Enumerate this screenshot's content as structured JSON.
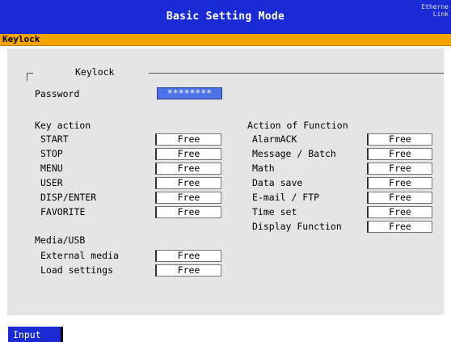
{
  "header": {
    "title": "Basic Setting Mode",
    "status_line1": "Etherne",
    "status_line2": "Link"
  },
  "breadcrumb": "Keylock",
  "group": {
    "title": "Keylock",
    "password_label": "Password",
    "password_value": "********"
  },
  "key_action": {
    "heading": "Key action",
    "items": [
      {
        "label": "START",
        "value": "Free"
      },
      {
        "label": "STOP",
        "value": "Free"
      },
      {
        "label": "MENU",
        "value": "Free"
      },
      {
        "label": "USER",
        "value": "Free"
      },
      {
        "label": "DISP/ENTER",
        "value": "Free"
      },
      {
        "label": "FAVORITE",
        "value": "Free"
      }
    ]
  },
  "media": {
    "heading": "Media/USB",
    "items": [
      {
        "label": "External media",
        "value": "Free"
      },
      {
        "label": "Load settings",
        "value": "Free"
      }
    ]
  },
  "function_action": {
    "heading": "Action of Function",
    "items": [
      {
        "label": "AlarmACK",
        "value": "Free"
      },
      {
        "label": "Message / Batch",
        "value": "Free"
      },
      {
        "label": "Math",
        "value": "Free"
      },
      {
        "label": "Data save",
        "value": "Free"
      },
      {
        "label": "E-mail / FTP",
        "value": "Free"
      },
      {
        "label": "Time set",
        "value": "Free"
      },
      {
        "label": "Display Function",
        "value": "Free"
      }
    ]
  },
  "footer": {
    "input_label": "Input"
  },
  "colors": {
    "title_bar": "#1a2bd6",
    "breadcrumb_bar": "#f5a300",
    "panel": "#e5e5e5",
    "selected_field": "#4e73e8"
  }
}
